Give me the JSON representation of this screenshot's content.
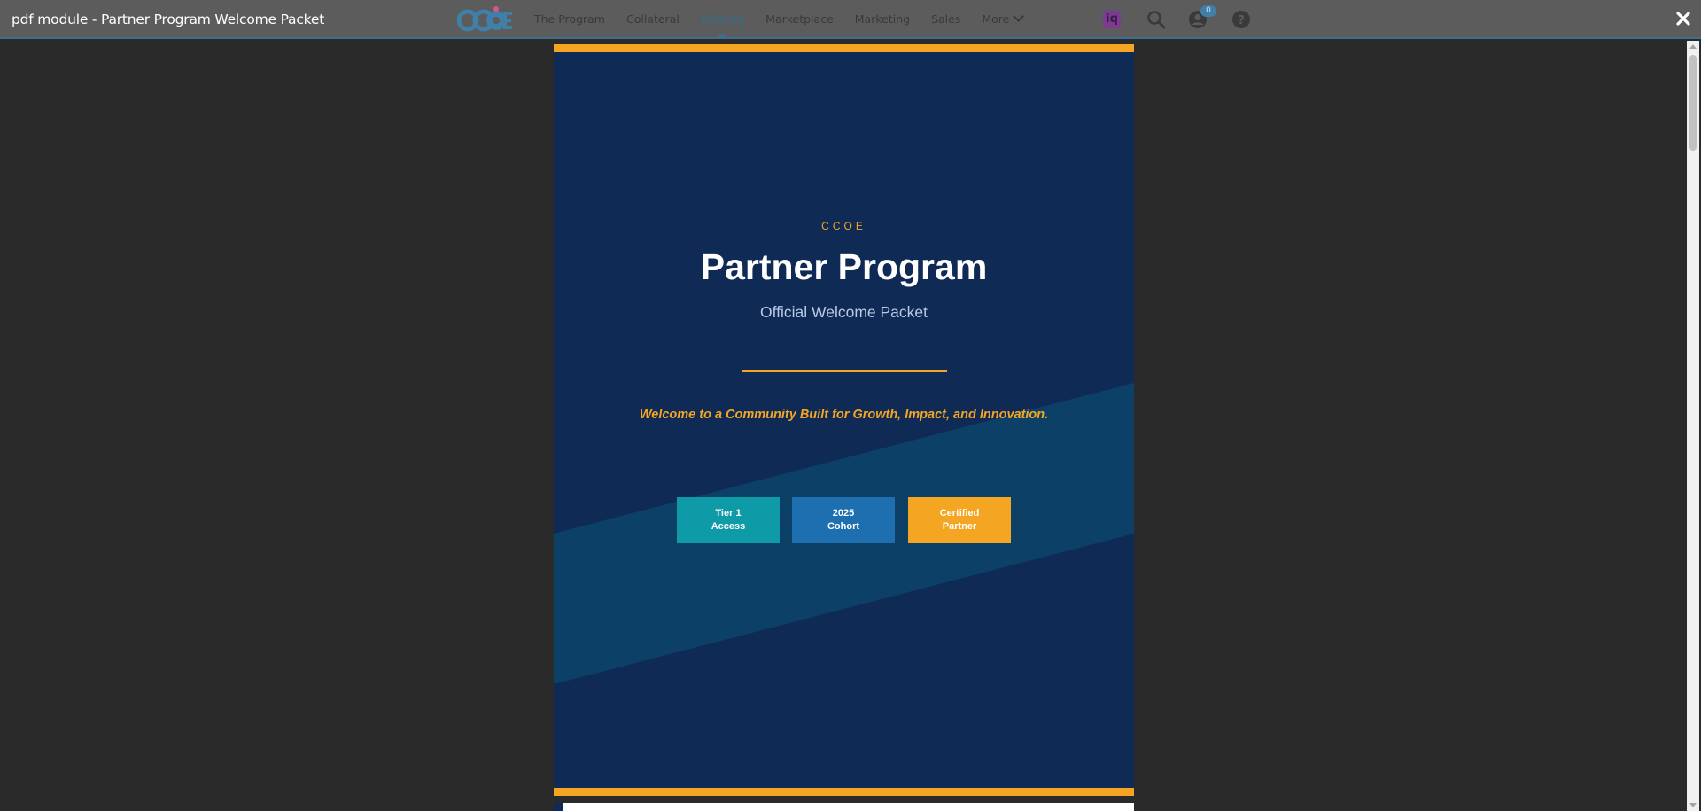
{
  "window": {
    "title": "pdf module - Partner Program Welcome Packet"
  },
  "nav": {
    "items": [
      {
        "label": "The Program",
        "active": false
      },
      {
        "label": "Collateral",
        "active": false
      },
      {
        "label": "Training",
        "active": true
      },
      {
        "label": "Marketplace",
        "active": false
      },
      {
        "label": "Marketing",
        "active": false
      },
      {
        "label": "Sales",
        "active": false
      },
      {
        "label": "More",
        "active": false
      }
    ]
  },
  "toolbar": {
    "iq_label": "iq",
    "notifications_count": "0",
    "icons": [
      "iq-icon",
      "search-icon",
      "user-icon",
      "help-icon",
      "close-icon"
    ]
  },
  "document": {
    "org": "CCOE",
    "title": "Partner Program",
    "subtitle": "Official Welcome Packet",
    "tagline": "Welcome to a Community Built for Growth, Impact, and Innovation.",
    "tiles": [
      {
        "line1": "Tier 1",
        "line2": "Access",
        "color": "#0f9aa8"
      },
      {
        "line1": "2025",
        "line2": "Cohort",
        "color": "#1d6fb0"
      },
      {
        "line1": "Certified",
        "line2": "Partner",
        "color": "#f4a623"
      }
    ],
    "colors": {
      "page_background": "#0e2a55",
      "accent": "#f4a623",
      "diagonal_band": "#0d4066"
    }
  }
}
